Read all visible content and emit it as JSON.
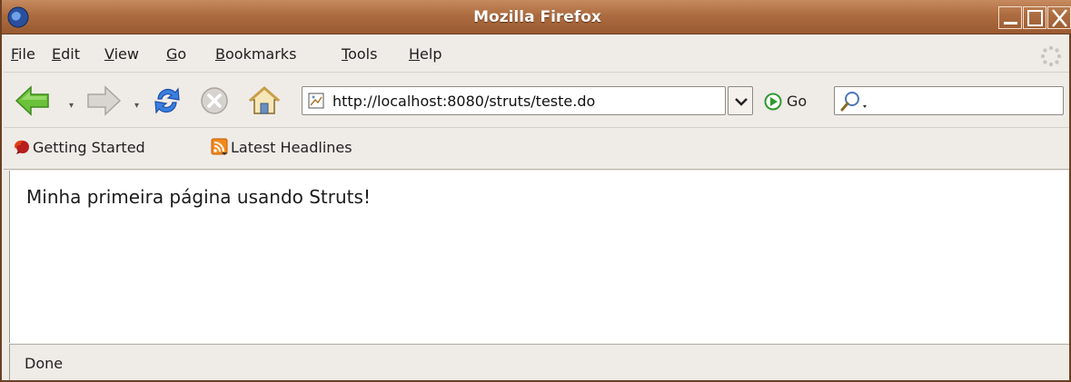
{
  "window": {
    "title": "Mozilla Firefox"
  },
  "menubar": {
    "items": [
      {
        "mnemonic": "F",
        "rest": "ile"
      },
      {
        "mnemonic": "E",
        "rest": "dit"
      },
      {
        "mnemonic": "V",
        "rest": "iew"
      },
      {
        "mnemonic": "G",
        "rest": "o"
      },
      {
        "mnemonic": "B",
        "rest": "ookmarks"
      },
      {
        "mnemonic": "T",
        "rest": "ools"
      },
      {
        "mnemonic": "H",
        "rest": "elp"
      }
    ]
  },
  "navbar": {
    "url": "http://localhost:8080/struts/teste.do",
    "go_label": "Go",
    "search_value": ""
  },
  "bookmarks": {
    "items": [
      {
        "label": "Getting Started",
        "icon": "firefox-icon"
      },
      {
        "label": "Latest Headlines",
        "icon": "rss-feed-icon"
      }
    ]
  },
  "content": {
    "text": "Minha primeira página usando Struts!"
  },
  "statusbar": {
    "text": "Done"
  },
  "colors": {
    "titlebar": "#ad6c40",
    "chrome": "#efebe7",
    "back_arrow": "#5cb82f",
    "reload": "#2f6fd6"
  }
}
